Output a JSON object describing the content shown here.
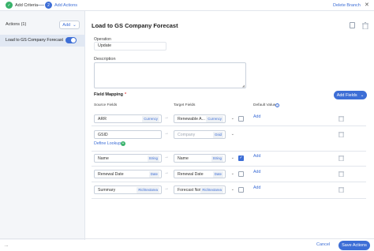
{
  "steps": [
    {
      "label": "Add Criteria",
      "state": "done",
      "icon": "check-icon"
    },
    {
      "label": "Add Actions",
      "state": "current",
      "number": "2"
    }
  ],
  "header": {
    "delete_branch": "Delete Branch",
    "close_icon": "close-icon"
  },
  "sidebar": {
    "title": "Actions (1)",
    "add_label": "Add",
    "items": [
      {
        "label": "Load to GS Company Forecast",
        "enabled": true
      }
    ]
  },
  "main": {
    "title": "Load to GS Company Forecast",
    "operation_label": "Operation",
    "operation_value": "Update",
    "description_label": "Description",
    "description_value": "",
    "field_mapping_label": "Field Mapping",
    "required_mark": "*",
    "add_fields_label": "Add Fields",
    "columns": {
      "source": "Source Fields",
      "target": "Target Fields",
      "default": "Default Value"
    },
    "define_lookup": "Define Lookup",
    "add_link": "Add",
    "rows": [
      {
        "source": "ARR",
        "source_type": "Currency",
        "target": "Renewable A...",
        "target_type": "Currency",
        "checked": false
      },
      {
        "source": "GSID",
        "source_type": "",
        "target": "Company",
        "target_type": "Gsid",
        "checked": false,
        "target_placeholder": true
      },
      {
        "source": "Name",
        "source_type": "String",
        "target": "Name",
        "target_type": "String",
        "checked": true
      },
      {
        "source": "Renewal Date",
        "source_type": "Date",
        "target": "Renewal Date",
        "target_type": "Date",
        "checked": false
      },
      {
        "source": "Summary",
        "source_type": "Richtextarea",
        "target": "Forecast Notes",
        "target_type": "Richtextarea",
        "checked": false
      }
    ]
  },
  "footer": {
    "left_text": "...",
    "cancel": "Cancel",
    "save": "Save Actions"
  },
  "colors": {
    "accent": "#3d6ed6",
    "success": "#38b26a",
    "sidebar_bg": "#f4f6f9",
    "selected_bg": "#e1e8f3"
  }
}
